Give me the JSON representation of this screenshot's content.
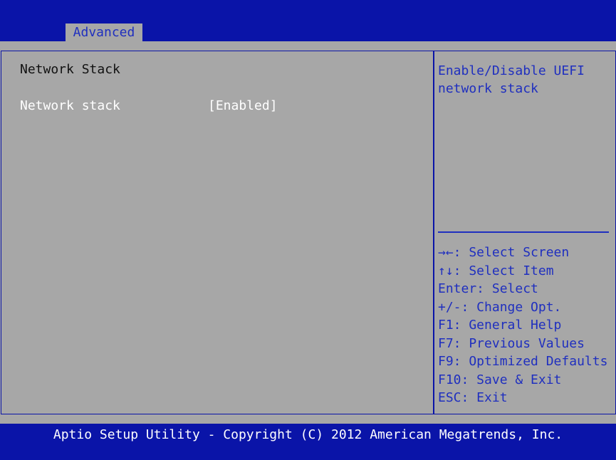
{
  "header": {
    "tab_label": "Advanced"
  },
  "main": {
    "section_title": "Network Stack",
    "setting": {
      "label": "Network stack",
      "value": "[Enabled]"
    }
  },
  "help": {
    "description": "Enable/Disable UEFI network stack",
    "keys": [
      "→←: Select Screen",
      "↑↓: Select Item",
      "Enter: Select",
      "+/-: Change Opt.",
      "F1: General Help",
      "F7: Previous Values",
      "F9: Optimized Defaults",
      "F10: Save & Exit",
      "ESC: Exit"
    ]
  },
  "footer": {
    "text": "Aptio Setup Utility - Copyright (C) 2012 American Megatrends, Inc."
  },
  "colors": {
    "background_blue": "#0a14a8",
    "panel_gray": "#a7a7a7",
    "help_text_blue": "#1f2fbf",
    "selected_text": "#ffffff"
  }
}
